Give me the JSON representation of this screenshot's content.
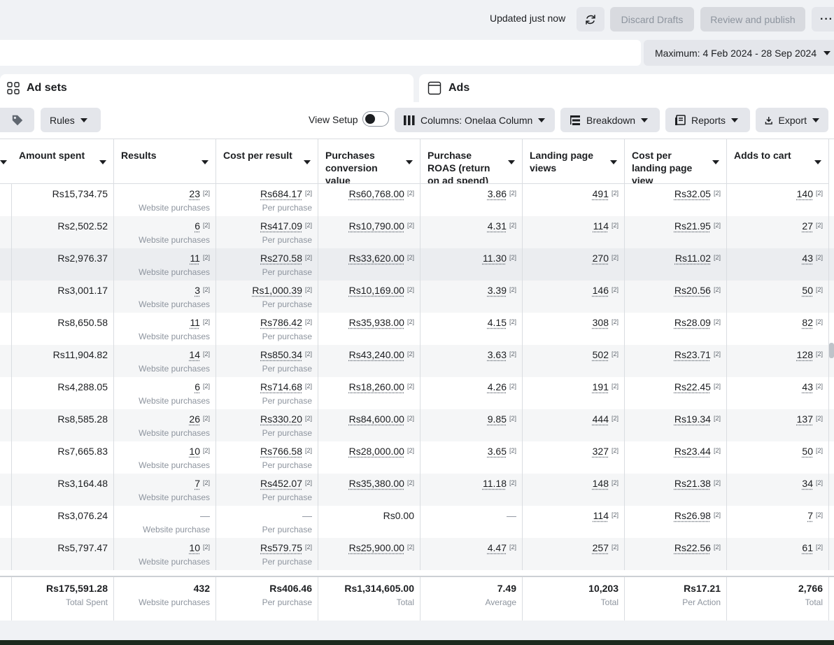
{
  "header": {
    "updated_text": "Updated just now",
    "refresh_icon": "refresh-icon",
    "discard_label": "Discard Drafts",
    "review_label": "Review and publish",
    "more_label": "···"
  },
  "date_range": "Maximum: 4 Feb 2024 - 28 Sep 2024",
  "tabs": [
    {
      "label": "Ad sets",
      "icon": "grid-icon"
    },
    {
      "label": "Ads",
      "icon": "ad-frame-icon"
    }
  ],
  "toolbar": {
    "tag_icon": "tag-icon",
    "rules_label": "Rules",
    "view_setup_label": "View Setup",
    "view_setup_on": false,
    "columns_label": "Columns: Onelaa Column",
    "breakdown_label": "Breakdown",
    "reports_label": "Reports",
    "export_label": "Export"
  },
  "columns": [
    "Amount spent",
    "Results",
    "Cost per result",
    "Purchases conversion value",
    "Purchase ROAS (return on ad spend)",
    "Landing page views",
    "Cost per landing page view",
    "Adds to cart"
  ],
  "rows": [
    {
      "spent": "Rs15,734.75",
      "results": "23",
      "results_sub": "Website purchases",
      "cpr": "Rs684.17",
      "cpr_sub": "Per purchase",
      "value": "Rs60,768.00",
      "roas": "3.86",
      "lpv": "491",
      "cplpv": "Rs32.05",
      "atc": "140"
    },
    {
      "spent": "Rs2,502.52",
      "results": "6",
      "results_sub": "Website purchases",
      "cpr": "Rs417.09",
      "cpr_sub": "Per purchase",
      "value": "Rs10,790.00",
      "roas": "4.31",
      "lpv": "114",
      "cplpv": "Rs21.95",
      "atc": "27"
    },
    {
      "spent": "Rs2,976.37",
      "results": "11",
      "results_sub": "Website purchases",
      "cpr": "Rs270.58",
      "cpr_sub": "Per purchase",
      "value": "Rs33,620.00",
      "roas": "11.30",
      "lpv": "270",
      "cplpv": "Rs11.02",
      "atc": "43"
    },
    {
      "spent": "Rs3,001.17",
      "results": "3",
      "results_sub": "Website purchases",
      "cpr": "Rs1,000.39",
      "cpr_sub": "Per purchase",
      "value": "Rs10,169.00",
      "roas": "3.39",
      "lpv": "146",
      "cplpv": "Rs20.56",
      "atc": "50"
    },
    {
      "spent": "Rs8,650.58",
      "results": "11",
      "results_sub": "Website purchases",
      "cpr": "Rs786.42",
      "cpr_sub": "Per purchase",
      "value": "Rs35,938.00",
      "roas": "4.15",
      "lpv": "308",
      "cplpv": "Rs28.09",
      "atc": "82"
    },
    {
      "spent": "Rs11,904.82",
      "results": "14",
      "results_sub": "Website purchases",
      "cpr": "Rs850.34",
      "cpr_sub": "Per purchase",
      "value": "Rs43,240.00",
      "roas": "3.63",
      "lpv": "502",
      "cplpv": "Rs23.71",
      "atc": "128"
    },
    {
      "spent": "Rs4,288.05",
      "results": "6",
      "results_sub": "Website purchases",
      "cpr": "Rs714.68",
      "cpr_sub": "Per purchase",
      "value": "Rs18,260.00",
      "roas": "4.26",
      "lpv": "191",
      "cplpv": "Rs22.45",
      "atc": "43"
    },
    {
      "spent": "Rs8,585.28",
      "results": "26",
      "results_sub": "Website purchases",
      "cpr": "Rs330.20",
      "cpr_sub": "Per purchase",
      "value": "Rs84,600.00",
      "roas": "9.85",
      "lpv": "444",
      "cplpv": "Rs19.34",
      "atc": "137"
    },
    {
      "spent": "Rs7,665.83",
      "results": "10",
      "results_sub": "Website purchases",
      "cpr": "Rs766.58",
      "cpr_sub": "Per purchase",
      "value": "Rs28,000.00",
      "roas": "3.65",
      "lpv": "327",
      "cplpv": "Rs23.44",
      "atc": "50"
    },
    {
      "spent": "Rs3,164.48",
      "results": "7",
      "results_sub": "Website purchases",
      "cpr": "Rs452.07",
      "cpr_sub": "Per purchase",
      "value": "Rs35,380.00",
      "roas": "11.18",
      "lpv": "148",
      "cplpv": "Rs21.38",
      "atc": "34"
    },
    {
      "spent": "Rs3,076.24",
      "results": "—",
      "results_sub": "Website purchase",
      "cpr": "—",
      "cpr_sub": "Per purchase",
      "value": "Rs0.00",
      "roas": "—",
      "lpv": "114",
      "cplpv": "Rs26.98",
      "atc": "7",
      "empty": true
    },
    {
      "spent": "Rs5,797.47",
      "results": "10",
      "results_sub": "Website purchases",
      "cpr": "Rs579.75",
      "cpr_sub": "Per purchase",
      "value": "Rs25,900.00",
      "roas": "4.47",
      "lpv": "257",
      "cplpv": "Rs22.56",
      "atc": "61"
    }
  ],
  "attribution_marker": "[2]",
  "totals": {
    "spent": "Rs175,591.28",
    "spent_sub": "Total Spent",
    "results": "432",
    "results_sub": "Website purchases",
    "cpr": "Rs406.46",
    "cpr_sub": "Per purchase",
    "value": "Rs1,314,605.00",
    "value_sub": "Total",
    "roas": "7.49",
    "roas_sub": "Average",
    "lpv": "10,203",
    "lpv_sub": "Total",
    "cplpv": "Rs17.21",
    "cplpv_sub": "Per Action",
    "atc": "2,766",
    "atc_sub": "Total"
  }
}
